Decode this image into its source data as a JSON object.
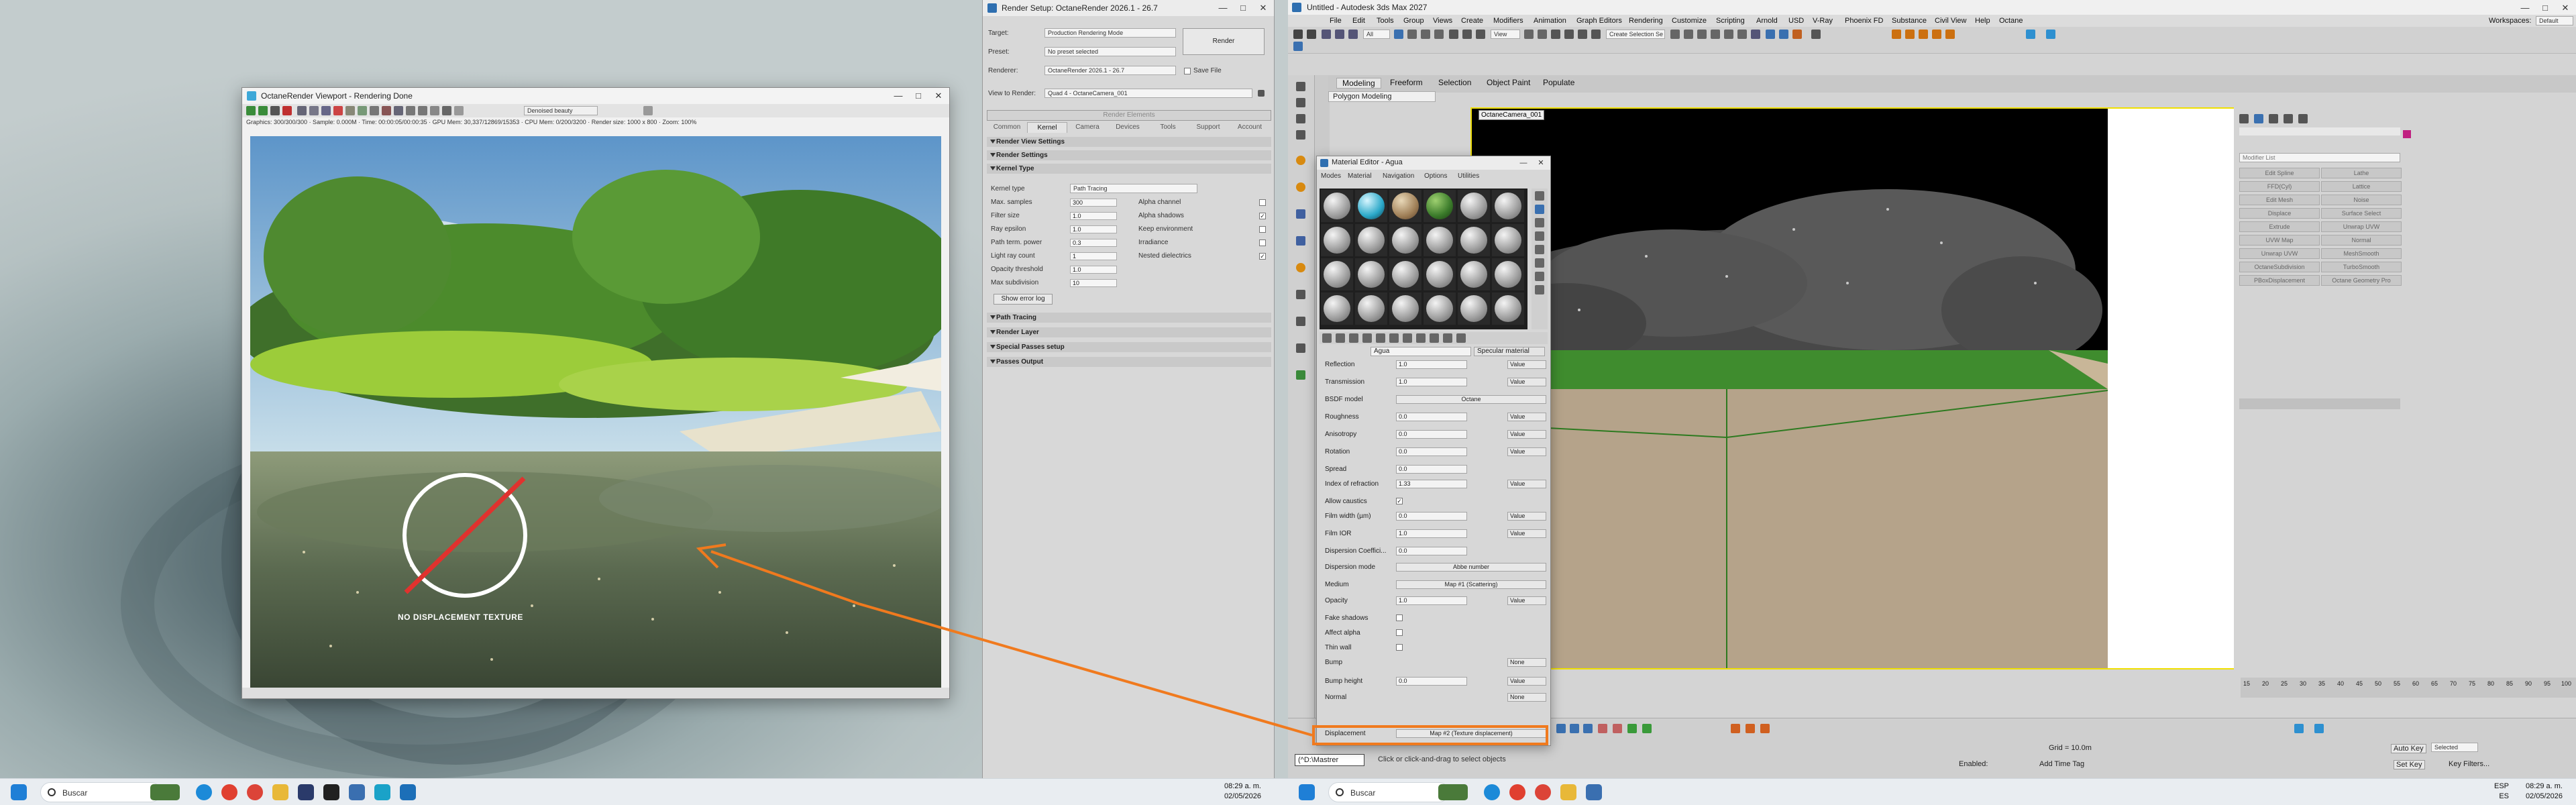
{
  "taskbar": {
    "search_left": "Buscar",
    "search_right": "Buscar",
    "time_left": "08:29 a. m.",
    "date_left": "02/05/2026",
    "time_right": "08:29 a. m.",
    "date_right": "02/05/2026",
    "lang": "ESP",
    "region": "ES"
  },
  "viewport_window": {
    "title": "OctaneRender Viewport - Rendering Done",
    "pass_dropdown": "Denoised beauty",
    "status_line": "Graphics: 300/300/300 · Sample: 0.000M · Time: 00:00:05/00:00:35 · GPU Mem: 30,337/12869/15353 · CPU Mem: 0/200/3200 · Render size: 1000 x 800 · Zoom: 100%",
    "overlay_text": "NO DISPLACEMENT TEXTURE"
  },
  "render_setup": {
    "title": "Render Setup: OctaneRender 2026.1 - 26.7",
    "target_label": "Target:",
    "target_value": "Production Rendering Mode",
    "preset_label": "Preset:",
    "preset_value": "No preset selected",
    "renderer_label": "Renderer:",
    "renderer_value": "OctaneRender 2026.1 - 26.7",
    "save_file": "Save File",
    "view_label": "View to Render:",
    "view_value": "Quad 4 - OctaneCamera_001",
    "render_button": "Render",
    "render_elements": "Render Elements",
    "tabs": [
      "Common",
      "Kernel",
      "Camera",
      "Devices",
      "Tools",
      "Support",
      "Account"
    ],
    "rollouts": [
      "Render View Settings",
      "Render Settings",
      "Kernel Type",
      "Path Tracing",
      "Render Layer",
      "Special Passes setup",
      "Passes Output"
    ],
    "kernel_type_label": "Kernel type",
    "kernel_type_value": "Path Tracing",
    "params": [
      {
        "label": "Max. samples",
        "value": "300"
      },
      {
        "label": "Filter size",
        "value": "1.0"
      },
      {
        "label": "Ray epsilon",
        "value": "1.0"
      },
      {
        "label": "Path term. power",
        "value": "0.3"
      },
      {
        "label": "Light ray count",
        "value": "1"
      },
      {
        "label": "Opacity threshold",
        "value": "1.0"
      },
      {
        "label": "Max subdivision",
        "value": "10"
      }
    ],
    "checks": [
      {
        "label": "Alpha channel",
        "checked": false
      },
      {
        "label": "Alpha shadows",
        "checked": true
      },
      {
        "label": "Keep environment",
        "checked": false
      },
      {
        "label": "Irradiance",
        "checked": false
      },
      {
        "label": "Nested dielectrics",
        "checked": true
      }
    ],
    "error_log_button": "Show error log"
  },
  "max": {
    "title": "Untitled - Autodesk 3ds Max 2027",
    "menus": [
      "File",
      "Edit",
      "Tools",
      "Group",
      "Views",
      "Create",
      "Modifiers",
      "Animation",
      "Graph Editors",
      "Rendering",
      "Customize",
      "Scripting",
      "Arnold",
      "USD",
      "V-Ray",
      "Phoenix FD",
      "Substance",
      "Civil View",
      "Help",
      "Octane"
    ],
    "workspaces_label": "Workspaces:",
    "workspaces_value": "Default",
    "ribbon_tabs": [
      "Modeling",
      "Freeform",
      "Selection",
      "Object Paint",
      "Populate"
    ],
    "ribbon_sub": "Polygon Modeling",
    "selection_set": "Create Selection Se",
    "view_dropdown": "View",
    "all_dropdown": "All",
    "viewport_label": "OctaneCamera_001",
    "status_prompt": "Click or click-and-drag to select objects",
    "maxscript": "(^D:\\Mastrer",
    "grid": "Grid = 10.0m",
    "enabled": "Enabled:",
    "add_time_tag": "Add Time Tag",
    "auto_key": "Auto Key",
    "selected": "Selected",
    "set_key": "Set Key",
    "key_filters": "Key Filters...",
    "modifier_list": "Modifier List",
    "command_buttons": [
      "Edit Spline",
      "Lathe",
      "FFD(Cyl)",
      "Lattice",
      "Edit Mesh",
      "Noise",
      "Displace",
      "Surface Select",
      "Extrude",
      "Unwrap UVW",
      "UVW Map",
      "Normal",
      "Unwrap UVW",
      "MeshSmooth",
      "OctaneSubdivision",
      "TurboSmooth",
      "PBoxDisplacement",
      "Octane Geometry Pro"
    ],
    "timeline_ticks": [
      "15",
      "20",
      "25",
      "30",
      "35",
      "40",
      "45",
      "50",
      "55",
      "60",
      "65",
      "70",
      "75",
      "80",
      "85",
      "90",
      "95",
      "100"
    ]
  },
  "material_editor": {
    "title": "Material Editor - Agua",
    "menus": [
      "Modes",
      "Material",
      "Navigation",
      "Options",
      "Utilities"
    ],
    "material_name": "Agua",
    "material_type": "Specular material",
    "params": [
      {
        "label": "Reflection",
        "value": "1.0",
        "mode": "Value"
      },
      {
        "label": "Transmission",
        "value": "1.0",
        "mode": "Value"
      },
      {
        "label": "BSDF model",
        "wide": "Octane"
      },
      {
        "label": "Roughness",
        "value": "0.0",
        "mode": "Value"
      },
      {
        "label": "Anisotropy",
        "value": "0.0",
        "mode": "Value"
      },
      {
        "label": "Rotation",
        "value": "0.0",
        "mode": "Value"
      },
      {
        "label": "Spread",
        "value": "0.0"
      },
      {
        "label": "Index of refraction",
        "value": "1.33",
        "mode": "Value"
      },
      {
        "label": "Allow caustics",
        "check": true
      },
      {
        "label": "Film width (µm)",
        "value": "0.0",
        "mode": "Value"
      },
      {
        "label": "Film IOR",
        "value": "1.0",
        "mode": "Value"
      },
      {
        "label": "Dispersion Coeffici...",
        "value": "0.0"
      },
      {
        "label": "Dispersion mode",
        "wide": "Abbe number"
      },
      {
        "label": "Medium",
        "wide": "Map #1 (Scattering)"
      },
      {
        "label": "Opacity",
        "value": "1.0",
        "mode": "Value"
      },
      {
        "label": "Fake shadows",
        "check": false
      },
      {
        "label": "Affect alpha",
        "check": false
      },
      {
        "label": "Thin wall",
        "check": false
      },
      {
        "label": "Bump",
        "mode": "None"
      },
      {
        "label": "Bump height",
        "value": "0.0",
        "mode": "Value"
      },
      {
        "label": "Normal",
        "mode": "None"
      },
      {
        "label": "Displacement",
        "wide": "Map #2 (Texture displacement)"
      }
    ]
  },
  "colors": {
    "highlight_orange": "#f07a1e",
    "viewport_border": "#f0e000",
    "grass": "#3f8c2e"
  }
}
